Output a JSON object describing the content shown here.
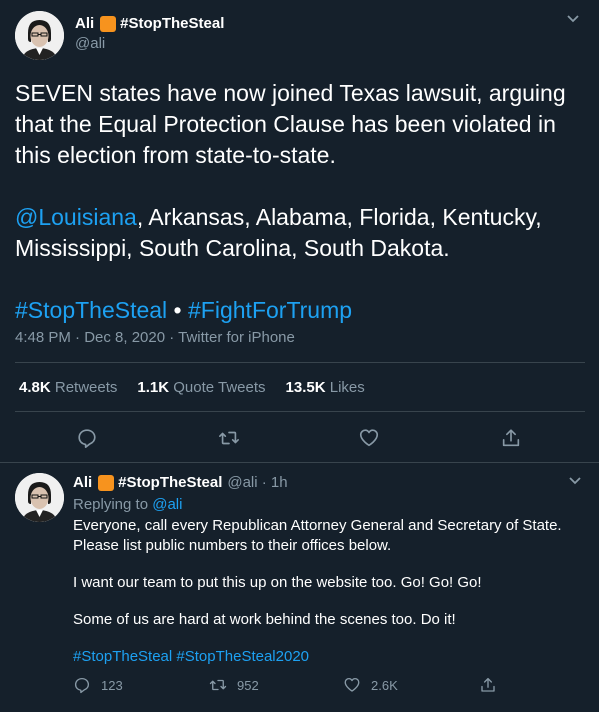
{
  "main_tweet": {
    "display_name": "Ali",
    "hashtag_name": "#StopTheSteal",
    "handle": "@ali",
    "text_line1": "SEVEN states have now joined Texas lawsuit, arguing that the Equal Protection Clause has been violated in this election from state-to-state.",
    "mention": "@Louisiana",
    "text_line2": ", Arkansas, Alabama, Florida, Kentucky, Mississippi, South Carolina, South Dakota.",
    "hashtag1": "#StopTheSteal",
    "bullet": " • ",
    "hashtag2": "#FightForTrump",
    "meta": "4:48 PM · Dec 8, 2020 · Twitter for iPhone",
    "stats": {
      "retweets_count": "4.8K",
      "retweets_label": "Retweets",
      "quotes_count": "1.1K",
      "quotes_label": "Quote Tweets",
      "likes_count": "13.5K",
      "likes_label": "Likes"
    }
  },
  "reply_tweet": {
    "display_name": "Ali",
    "hashtag_name": "#StopTheSteal",
    "handle_time": "@ali · 1h",
    "replying_prefix": "Replying to ",
    "replying_handle": "@ali",
    "para1": "Everyone, call every Republican Attorney General and Secretary of State. Please list public numbers to their offices below.",
    "para2": "I want our team to put this up on the website too. Go! Go! Go!",
    "para3": "Some of us are hard at work behind the scenes too. Do it!",
    "hashtags": "#StopTheSteal #StopTheSteal2020",
    "reply_count": "123",
    "retweet_count": "952",
    "like_count": "2.6K"
  },
  "colors": {
    "background": "#15202b",
    "link": "#1da1f2",
    "muted": "#8899a6",
    "divider": "#38444d",
    "badge": "#f7931e"
  }
}
